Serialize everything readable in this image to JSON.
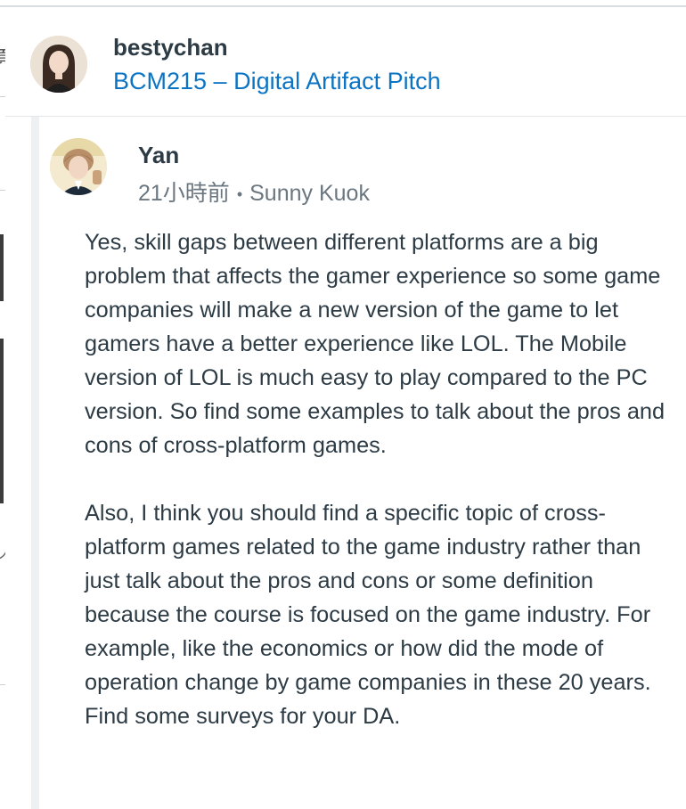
{
  "parent": {
    "author": "bestychan",
    "topic": "BCM215 – Digital Artifact Pitch"
  },
  "reply": {
    "author": "Yan",
    "time": "21小時前",
    "separator": "•",
    "reply_to": "Sunny Kuok",
    "paragraphs": [
      "Yes, skill gaps between different platforms are a big problem that affects the gamer experience so some game companies will make a new version of the game to let gamers have a better experience like LOL. The Mobile version of LOL is much easy to play compared to the PC version. So find some examples to talk about the pros and cons of cross-platform games.",
      "Also, I think you should find a specific topic of cross-platform games related to the game industry rather than just talk about the pros and cons or some definition because the course is focused on the game industry. For example, like the economics or how did the mode of operation change by game companies in these 20 years. Find some surveys for your DA."
    ]
  },
  "sidebar_fragment": {
    "glyph": "頁",
    "glyph2": "ノ"
  },
  "colors": {
    "link": "#0b74c4",
    "text": "#2d3b45",
    "muted": "#6b7780",
    "reply_bar": "#eef0f2"
  }
}
